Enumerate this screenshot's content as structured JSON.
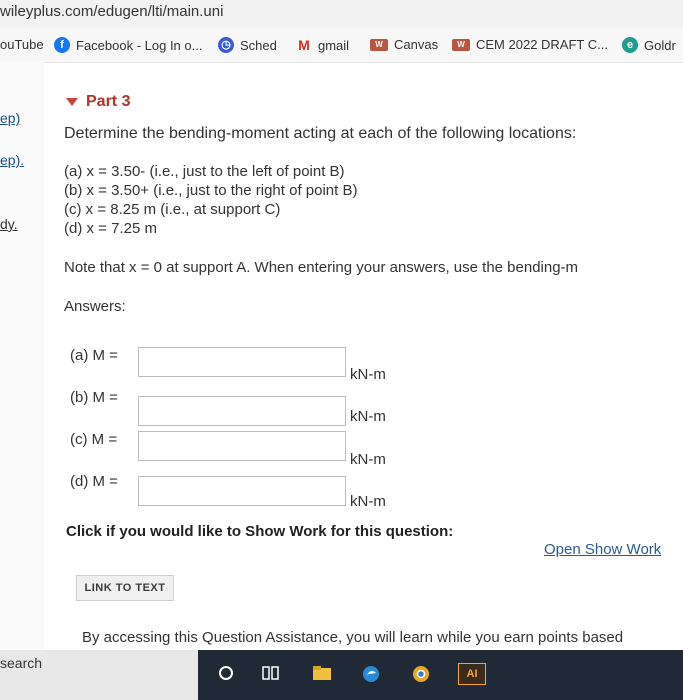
{
  "browser": {
    "url": "wileyplus.com/edugen/lti/main.uni",
    "bookmarks": [
      {
        "label": "ouTube"
      },
      {
        "label": "Facebook - Log In o..."
      },
      {
        "label": "Sched"
      },
      {
        "label": "gmail"
      },
      {
        "label": "Canvas"
      },
      {
        "label": "CEM 2022 DRAFT C..."
      },
      {
        "label": "Goldr"
      }
    ]
  },
  "sidebar": {
    "links": [
      "ep)",
      "ep).",
      "dy."
    ]
  },
  "part": {
    "title": "Part 3",
    "question": "Determine the bending-moment acting at each of the following locations:",
    "items": [
      "(a) x = 3.50- (i.e., just to the left of point B)",
      "(b) x = 3.50+ (i.e., just to the right of point B)",
      "(c) x = 8.25 m (i.e., at support C)",
      "(d) x = 7.25 m"
    ],
    "note": "Note that x = 0 at support A. When entering your answers, use the bending-m",
    "answers_label": "Answers:"
  },
  "answers": [
    {
      "label": "(a) M =",
      "value": "",
      "unit": "kN-m"
    },
    {
      "label": "(b) M =",
      "value": "",
      "unit": "kN-m"
    },
    {
      "label": "(c) M =",
      "value": "",
      "unit": "kN-m"
    },
    {
      "label": "(d) M =",
      "value": "",
      "unit": "kN-m"
    }
  ],
  "show_work": {
    "prompt": "Click if you would like to Show Work for this question:",
    "link": "Open Show Work"
  },
  "link_to_text": "LINK TO TEXT",
  "assistance": "By accessing this Question Assistance, you will learn while you earn points based",
  "taskbar": {
    "search": "search",
    "app_label": "AI"
  },
  "colors": {
    "part_accent": "#b3322a",
    "link": "#2b5a95",
    "taskbar": "#1f2a36"
  }
}
